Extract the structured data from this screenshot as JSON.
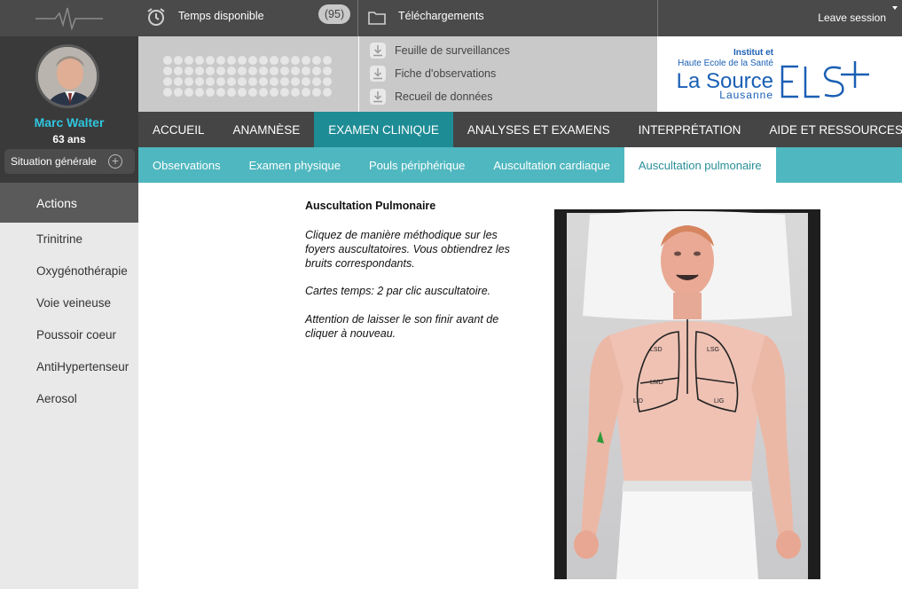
{
  "patient": {
    "name": "Marc Walter",
    "age": "63 ans"
  },
  "sidebar": {
    "situation_label": "Situation générale",
    "actions_header": "Actions",
    "actions": [
      "Trinitrine",
      "Oxygénothérapie",
      "Voie veineuse",
      "Poussoir coeur",
      "AntiHypertenseur",
      "Aerosol"
    ]
  },
  "topbar": {
    "time_label": "Temps disponible",
    "time_value": "(95)",
    "downloads_label": "Téléchargements",
    "leave_label": "Leave session"
  },
  "downloads": [
    "Feuille de surveillances",
    "Fiche d'observations",
    "Recueil de données"
  ],
  "brand": {
    "line1": "Institut et",
    "line2": "Haute Ecole de la Santé",
    "name": "La Source",
    "city": "Lausanne",
    "mark": "ELS+",
    "color": "#1a5fb4"
  },
  "main_nav": {
    "tabs": [
      "ACCUEIL",
      "ANAMNÈSE",
      "EXAMEN CLINIQUE",
      "ANALYSES ET EXAMENS",
      "INTERPRÉTATION",
      "AIDE ET RESSOURCES"
    ],
    "active": "EXAMEN CLINIQUE"
  },
  "sub_nav": {
    "tabs": [
      "Observations",
      "Examen physique",
      "Pouls périphérique",
      "Auscultation cardiaque",
      "Auscultation pulmonaire"
    ],
    "active": "Auscultation pulmonaire"
  },
  "content": {
    "title": "Auscultation Pulmonaire",
    "para1": "Cliquez de manière méthodique sur les foyers auscultatoires. Vous obtiendrez les bruits correspondants.",
    "para2": "Cartes temps: 2 par clic auscultatoire.",
    "para3": "Attention de laisser le son finir avant de cliquer à nouveau.",
    "lung_labels": [
      "LSD",
      "LSG",
      "LMD",
      "LID",
      "LIG"
    ]
  },
  "colors": {
    "accent": "#1e8c95",
    "subnav": "#4fb7bf",
    "name": "#2fc6e0"
  }
}
